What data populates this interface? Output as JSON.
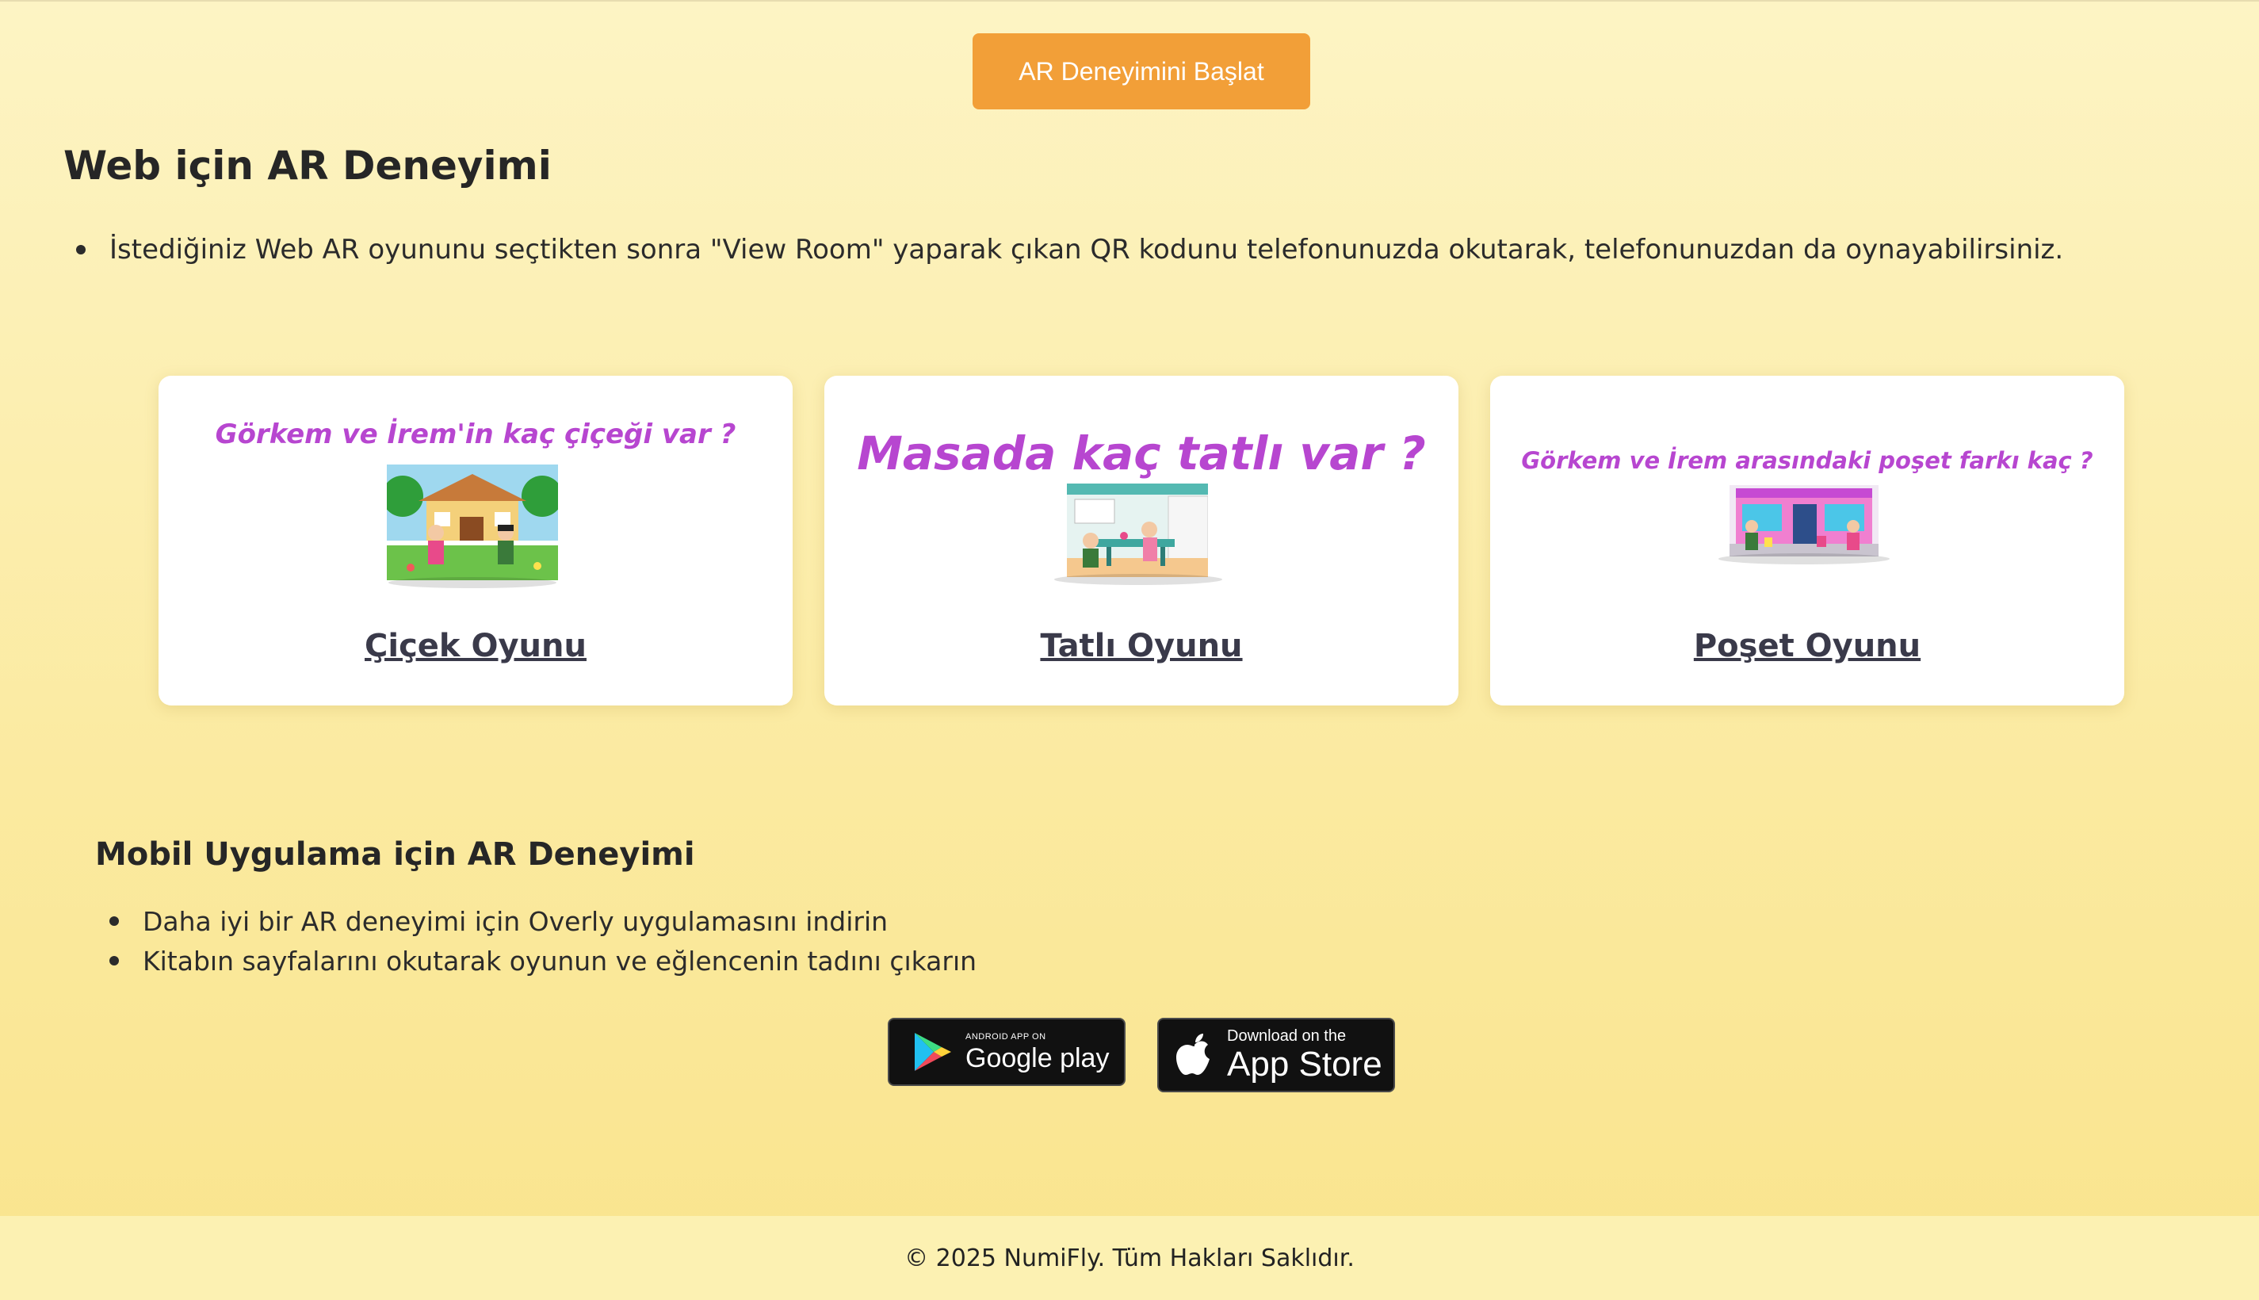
{
  "header": {
    "start_button": "AR Deneyimini Başlat"
  },
  "web_section": {
    "title": "Web için AR Deneyimi",
    "instruction": "İstediğiniz Web AR oyununu seçtikten sonra \"View Room\" yaparak çıkan QR kodunu telefonunuzda okutarak, telefonunuzdan da oynayabilirsiniz."
  },
  "games": [
    {
      "image_title": "Görkem ve İrem'in kaç çiçeği var ?",
      "link": "Çiçek Oyunu"
    },
    {
      "image_title": "Masada kaç tatlı var ?",
      "link": "Tatlı Oyunu"
    },
    {
      "image_title": "Görkem ve İrem arasındaki poşet farkı kaç ?",
      "link": "Poşet Oyunu"
    }
  ],
  "mobile_section": {
    "title": "Mobil Uygulama için AR Deneyimi",
    "items": [
      "Daha iyi bir AR deneyimi için Overly uygulamasını indirin",
      "Kitabın sayfalarını okutarak oyunun ve eğlencenin tadını çıkarın"
    ]
  },
  "badges": {
    "google_small": "ANDROID APP ON",
    "google_big": "Google play",
    "apple_small": "Download on the",
    "apple_big": "App Store"
  },
  "footer": {
    "text": "© 2025 NumiFly. Tüm Hakları Saklıdır."
  },
  "colors": {
    "accent": "#f29f38",
    "card_title": "#b746d0",
    "background": "#fbeaa0"
  }
}
